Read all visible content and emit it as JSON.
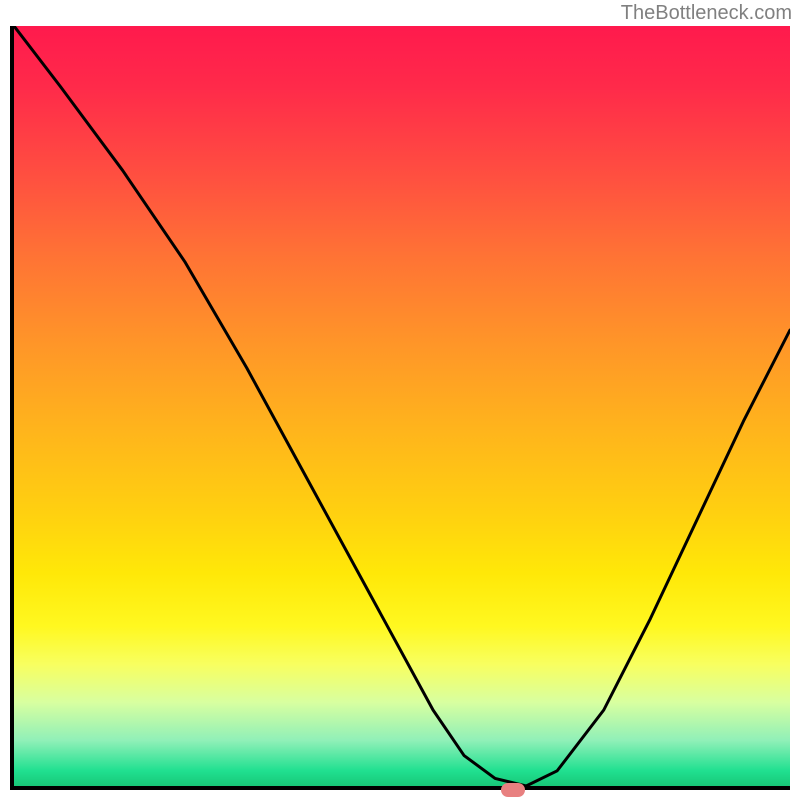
{
  "watermark": "TheBottleneck.com",
  "chart_data": {
    "type": "line",
    "title": "",
    "xlabel": "",
    "ylabel": "",
    "xlim": [
      0,
      100
    ],
    "ylim": [
      0,
      100
    ],
    "grid": false,
    "series": [
      {
        "name": "bottleneck-curve",
        "x": [
          0,
          6,
          14,
          22,
          30,
          38,
          46,
          54,
          58,
          62,
          66,
          70,
          76,
          82,
          88,
          94,
          100
        ],
        "values": [
          100,
          92,
          81,
          69,
          55,
          40,
          25,
          10,
          4,
          1,
          0,
          2,
          10,
          22,
          35,
          48,
          60
        ]
      }
    ],
    "marker": {
      "x": 64,
      "y": 0,
      "color": "#e88080"
    },
    "background_gradient": {
      "stops": [
        {
          "pos": 0,
          "color": "#ff1a4d"
        },
        {
          "pos": 20,
          "color": "#ff5040"
        },
        {
          "pos": 42,
          "color": "#ff9628"
        },
        {
          "pos": 64,
          "color": "#ffd010"
        },
        {
          "pos": 79,
          "color": "#fff820"
        },
        {
          "pos": 89,
          "color": "#d8ffa0"
        },
        {
          "pos": 100,
          "color": "#18c878"
        }
      ]
    }
  }
}
